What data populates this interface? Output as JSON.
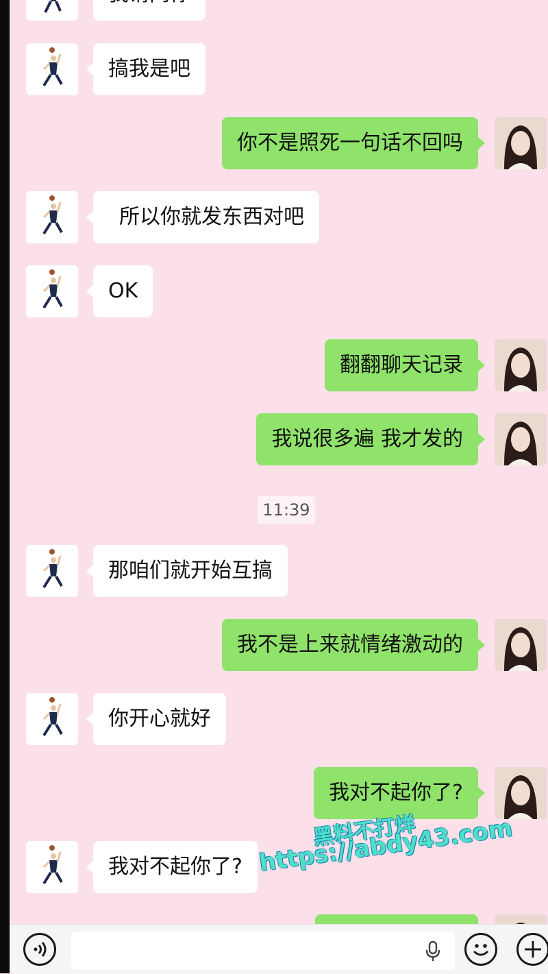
{
  "messages": [
    {
      "id": "m0",
      "side": "other",
      "text": "我请问你"
    },
    {
      "id": "m1",
      "side": "other",
      "text": "搞我是吧"
    },
    {
      "id": "m2",
      "side": "me",
      "text": "你不是照死一句话不回吗"
    },
    {
      "id": "m3",
      "side": "other",
      "text": "所以你就发东西对吧"
    },
    {
      "id": "m4",
      "side": "other",
      "text": "OK"
    },
    {
      "id": "m5",
      "side": "me",
      "text": "翻翻聊天记录"
    },
    {
      "id": "m6",
      "side": "me",
      "text": "我说很多遍 我才发的"
    },
    {
      "id": "m7",
      "side": "other",
      "text": "那咱们就开始互搞"
    },
    {
      "id": "m8",
      "side": "me",
      "text": "我不是上来就情绪激动的"
    },
    {
      "id": "m9",
      "side": "other",
      "text": "你开心就好"
    },
    {
      "id": "m10",
      "side": "me",
      "text": "我对不起你了?"
    },
    {
      "id": "m11",
      "side": "other",
      "text": "我对不起你了?"
    }
  ],
  "timestamp": "11:39",
  "watermark": {
    "line1": "黑料不打烊",
    "line2": "https://abdy43.com"
  },
  "input_bar": {
    "voice_icon": "voice-icon",
    "mic_icon": "microphone-icon",
    "emoji_icon": "emoji-icon",
    "plus_icon": "plus-icon"
  },
  "colors": {
    "chat_background": "#fbe0ea",
    "my_bubble": "#8fe36a",
    "their_bubble": "#ffffff"
  }
}
